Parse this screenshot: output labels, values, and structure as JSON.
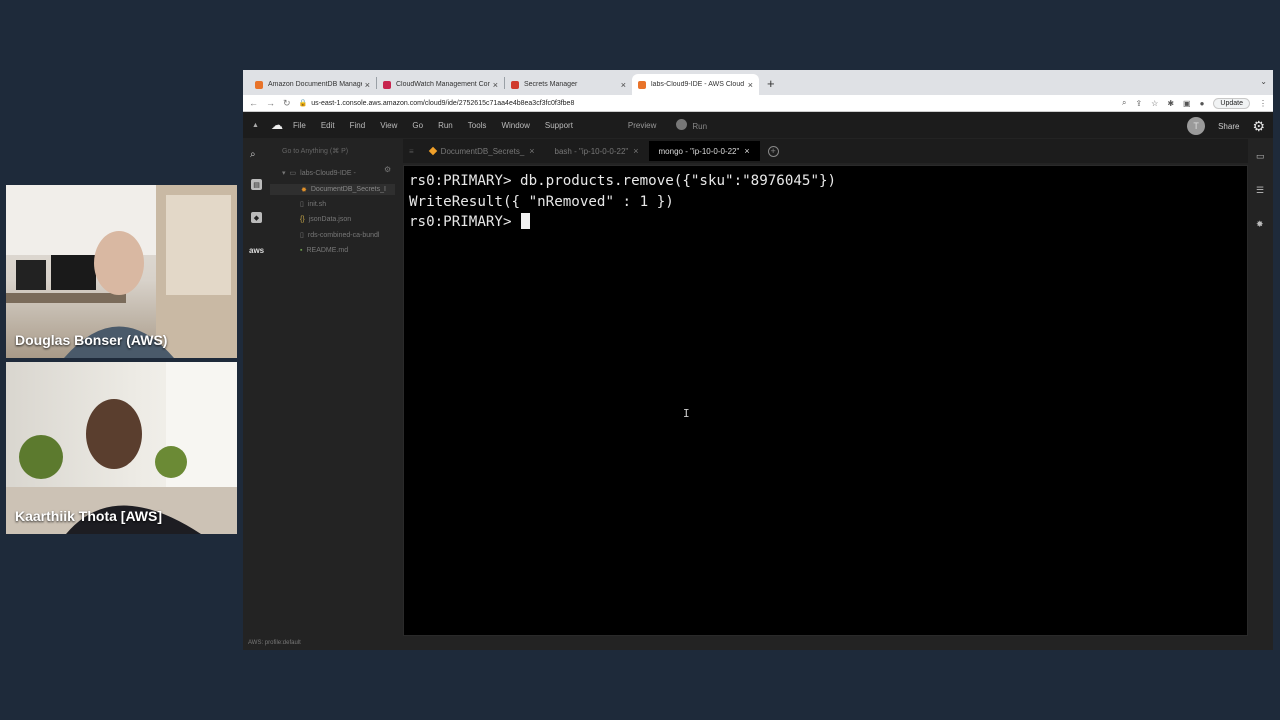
{
  "participants": [
    {
      "name": "Douglas Bonser (AWS)"
    },
    {
      "name": "Kaarthiik Thota [AWS]"
    }
  ],
  "browser": {
    "tabs": [
      {
        "title": "Amazon DocumentDB Manage",
        "favicon_color": "#e8732a",
        "active": false
      },
      {
        "title": "CloudWatch Management Con",
        "favicon_color": "#c7254e",
        "active": false
      },
      {
        "title": "Secrets Manager",
        "favicon_color": "#d03a2c",
        "active": false
      },
      {
        "title": "labs-Cloud9-IDE - AWS Cloud",
        "favicon_color": "#e8732a",
        "active": true
      }
    ],
    "url": "us-east-1.console.aws.amazon.com/cloud9/ide/2752615c71aa4e4b8ea3cf3fc0f3fbe8",
    "update_label": "Update"
  },
  "cloud9": {
    "menu": [
      "File",
      "Edit",
      "Find",
      "View",
      "Go",
      "Run",
      "Tools",
      "Window",
      "Support"
    ],
    "preview": "Preview",
    "run": "Run",
    "avatar_initial": "T",
    "share": "Share",
    "goto_placeholder": "Go to Anything (⌘ P)",
    "tree": {
      "root": "labs-Cloud9-IDE -",
      "files": [
        {
          "name": "DocumentDB_Secrets_I",
          "icon": "gear-file-icon"
        },
        {
          "name": "init.sh",
          "icon": "file-icon"
        },
        {
          "name": "jsonData.json",
          "icon": "json-icon"
        },
        {
          "name": "rds-combined-ca-bundl",
          "icon": "file-icon"
        },
        {
          "name": "README.md",
          "icon": "md-icon"
        }
      ]
    },
    "editor_tabs": [
      {
        "label": "DocumentDB_Secrets_",
        "active": false
      },
      {
        "label": "bash - \"ip-10-0-0-22\"",
        "active": false
      },
      {
        "label": "mongo - \"ip-10-0-0-22\"",
        "active": true
      }
    ],
    "terminal_lines": [
      "rs0:PRIMARY> db.products.remove({\"sku\":\"8976045\"})",
      "WriteResult({ \"nRemoved\" : 1 })",
      "rs0:PRIMARY> "
    ],
    "status": "AWS: profile:default"
  }
}
